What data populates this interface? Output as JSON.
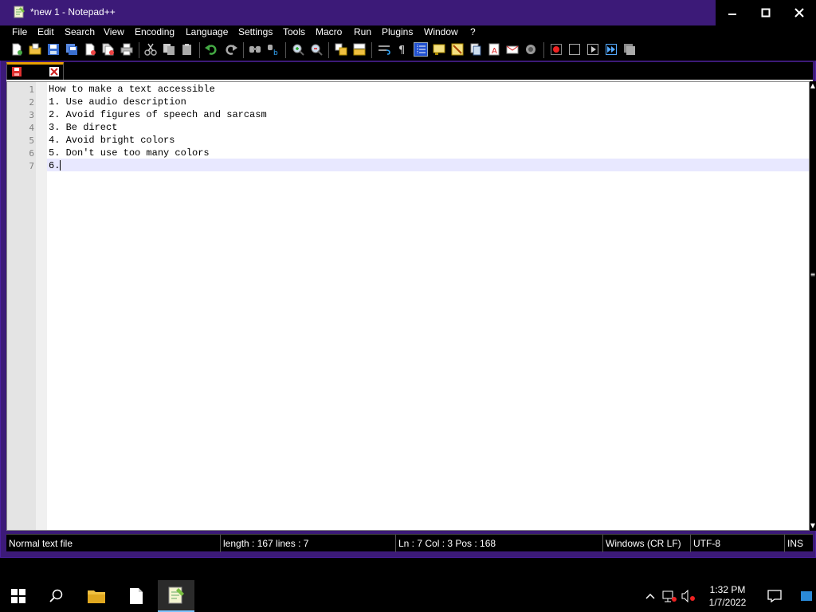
{
  "window": {
    "title": "*new 1 - Notepad++",
    "controls": {
      "minimize": "—",
      "maximize": "☐",
      "close": "✕"
    },
    "accent": "#3c1a78"
  },
  "menu": [
    {
      "label": "File"
    },
    {
      "label": "Edit"
    },
    {
      "label": "Search"
    },
    {
      "label": "View"
    },
    {
      "label": "Encoding"
    },
    {
      "label": "Language"
    },
    {
      "label": "Settings"
    },
    {
      "label": "Tools"
    },
    {
      "label": "Macro"
    },
    {
      "label": "Run"
    },
    {
      "label": "Plugins"
    },
    {
      "label": "Window"
    },
    {
      "label": "?"
    }
  ],
  "toolbar_icons": [
    "new-file-icon",
    "open-file-icon",
    "save-icon",
    "save-all-icon",
    "close-icon",
    "close-all-icon",
    "print-icon",
    "cut-icon",
    "copy-icon",
    "paste-icon",
    "undo-icon",
    "redo-icon",
    "find-icon",
    "replace-icon",
    "zoom-in-icon",
    "zoom-out-icon",
    "sync-vertical-icon",
    "sync-horizontal-icon",
    "word-wrap-icon",
    "show-all-chars-icon",
    "indent-guide-icon",
    "user-language-icon",
    "doc-map-icon",
    "function-list-icon",
    "folder-workspace-icon",
    "monitoring-icon",
    "spell-icon",
    "macro-record-icon",
    "macro-stop-icon",
    "macro-play-icon",
    "macro-run-multiple-icon",
    "macro-save-icon"
  ],
  "tab": {
    "label": "",
    "save_icon": "save-icon",
    "close_icon": "close-icon"
  },
  "editor": {
    "lines": [
      {
        "num": "1",
        "text": "How to make a text accessible"
      },
      {
        "num": "2",
        "text": "1. Use audio description"
      },
      {
        "num": "3",
        "text": "2. Avoid figures of speech and sarcasm"
      },
      {
        "num": "4",
        "text": "3. Be direct"
      },
      {
        "num": "5",
        "text": "4. Avoid bright colors"
      },
      {
        "num": "6",
        "text": "5. Don't use too many colors"
      },
      {
        "num": "7",
        "text": "6."
      }
    ],
    "current_line": 7
  },
  "status": {
    "file_type": "Normal text file",
    "length": "length : 167    lines : 7",
    "position": "Ln : 7    Col : 3    Pos : 168",
    "eol": "Windows (CR LF)",
    "encoding": "UTF-8",
    "mode": "INS"
  },
  "taskbar": {
    "apps": [
      "start-icon",
      "search-icon",
      "file-explorer-icon",
      "notepad-icon",
      "notepadpp-icon"
    ],
    "clock": {
      "time": "1:32 PM",
      "date": "1/7/2022"
    }
  }
}
